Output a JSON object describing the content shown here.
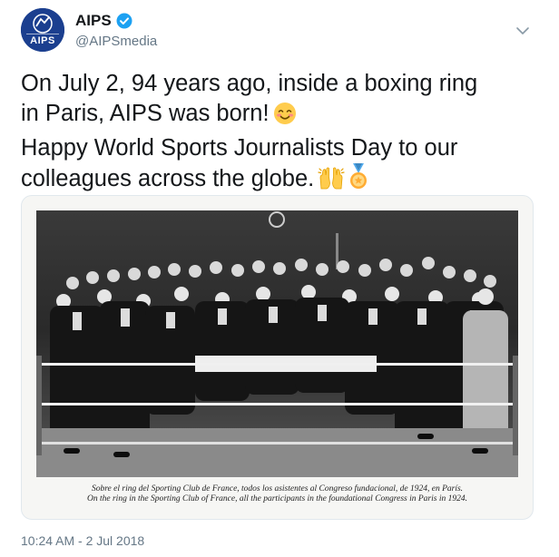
{
  "author": {
    "display_name": "AIPS",
    "handle": "@AIPSmedia",
    "avatar_text": "AIPS",
    "verified": true,
    "avatar_color": "#1b3f8f"
  },
  "tweet": {
    "text_lines": [
      "On July 2, 94 years ago, inside a boxing ring",
      "in Paris, AIPS was born!",
      "Happy World Sports Journalists Day to our",
      "colleagues across the globe."
    ],
    "emojis": [
      "smiling-face-emoji",
      "raised-hands-emoji",
      "medal-emoji"
    ]
  },
  "media": {
    "caption_spanish": "Sobre el ring del Sporting Club de France, todos los asistentes al Congreso fundacional, de 1924, en París.",
    "caption_english": "On the ring in the Sporting Club of France, all the participants in the foundational Congress in Paris in 1924."
  },
  "timestamp": "10:24 AM - 2 Jul 2018",
  "colors": {
    "text": "#14171a",
    "secondary": "#657786",
    "verified_blue": "#1da1f2",
    "border": "#e1e8ed"
  }
}
